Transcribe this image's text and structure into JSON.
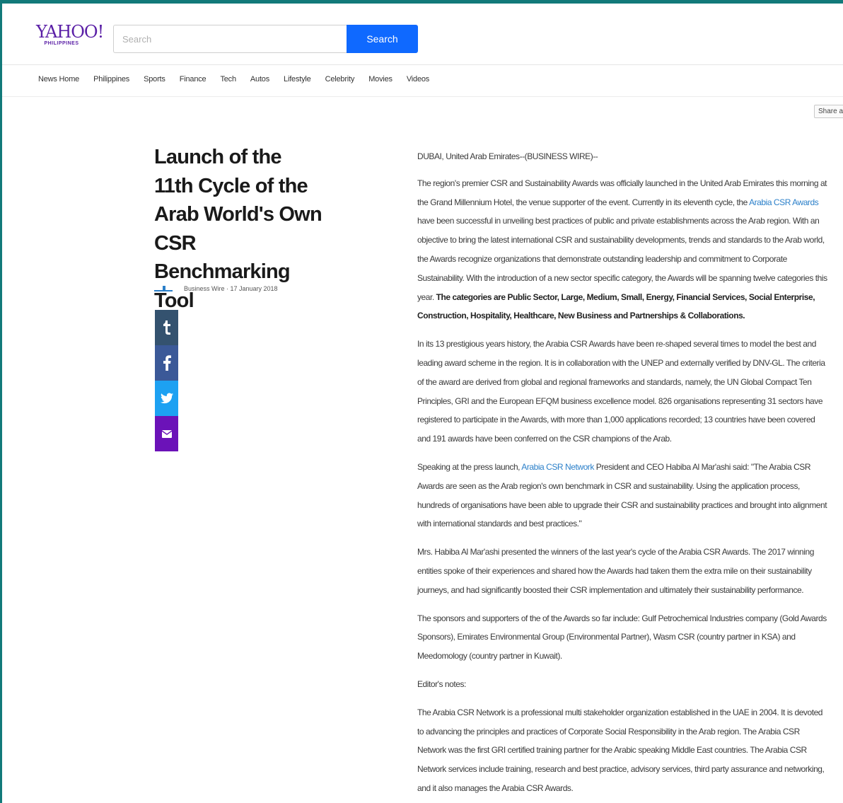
{
  "header": {
    "logo_text": "YAHOO!",
    "logo_region": "PHILIPPINES",
    "search_placeholder": "Search",
    "search_button": "Search",
    "share_all_label": "Share all"
  },
  "nav": {
    "items": [
      "News Home",
      "Philippines",
      "Sports",
      "Finance",
      "Tech",
      "Autos",
      "Lifestyle",
      "Celebrity",
      "Movies",
      "Videos"
    ]
  },
  "article": {
    "headline": "Launch of the 11th Cycle of the Arab World's Own CSR Benchmarking Tool",
    "byline": "Business Wire · 17 January 2018",
    "dateline": "DUBAI, United Arab Emirates--(BUSINESS WIRE)--",
    "p1_a": "The region's premier CSR and Sustainability Awards was officially launched in the United Arab Emirates this morning at the Grand Millennium Hotel, the venue supporter of the event. Currently in its eleventh cycle, the ",
    "p1_link": "Arabia CSR Awards",
    "p1_b": " have been successful in unveiling best practices of public and private establishments across the Arab region. With an objective to bring the latest international CSR and sustainability developments, trends and standards to the Arab world, the Awards recognize organizations that demonstrate outstanding leadership and commitment to Corporate Sustainability. With the introduction of a new sector specific category, the Awards will be spanning twelve categories this year. ",
    "p1_bold": "The categories are Public Sector, Large, Medium, Small, Energy, Financial Services, Social Enterprise, Construction, Hospitality, Healthcare, New Business and Partnerships & Collaborations.",
    "p2": "In its 13 prestigious years history, the Arabia CSR Awards have been re-shaped several times to model the best and leading award scheme in the region. It is in collaboration with the UNEP and externally verified by DNV-GL. The criteria of the award are derived from global and regional frameworks and standards, namely, the UN Global Compact Ten Principles, GRI and the European EFQM business excellence model. 826 organisations representing 31 sectors have registered to participate in the Awards, with more than 1,000 applications recorded; 13 countries have been covered and 191 awards have been conferred on the CSR champions of the Arab.",
    "p3_a": "Speaking at the press launch, ",
    "p3_link": "Arabia CSR Network",
    "p3_b": " President and CEO Habiba Al Mar'ashi said: \"The Arabia CSR Awards are seen as the Arab region's own benchmark in CSR and sustainability. Using the application process, hundreds of organisations have been able to upgrade their CSR and sustainability practices and brought into alignment with international standards and best practices.\"",
    "p4": "Mrs. Habiba Al Mar'ashi presented the winners of the last year's cycle of the Arabia CSR Awards. The 2017 winning entities spoke of their experiences and shared how the Awards had taken them the extra mile on their sustainability journeys, and had significantly boosted their CSR implementation and ultimately their sustainability performance.",
    "p5": "The sponsors and supporters of the of the Awards so far include: Gulf Petrochemical Industries company (Gold Awards Sponsors), Emirates Environmental Group (Environmental Partner), Wasm CSR (country partner in KSA) and Meedomology (country partner in Kuwait).",
    "p6": "Editor's notes:",
    "p7": "The Arabia CSR Network is a professional multi stakeholder organization established in the UAE in 2004. It is devoted to advancing the principles and practices of Corporate Social Responsibility in the Arab region. The Arabia CSR Network was the first GRI certified training partner for the Arabic speaking Middle East countries. The Arabia CSR Network services include training, research and best practice, advisory services, third party assurance and networking, and it also manages the Arabia CSR Awards."
  }
}
